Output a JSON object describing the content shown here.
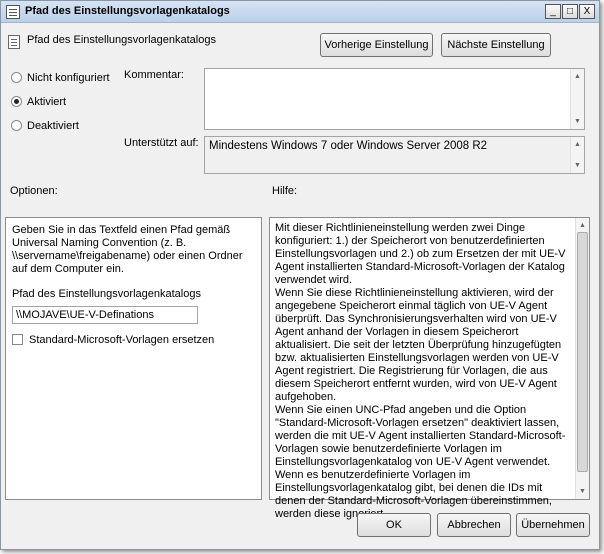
{
  "window": {
    "title": "Pfad des Einstellungsvorlagenkatalogs",
    "min": "_",
    "max": "□",
    "close": "X"
  },
  "header": {
    "title": "Pfad des Einstellungsvorlagenkatalogs",
    "prev_button": "Vorherige Einstellung",
    "next_button": "Nächste Einstellung"
  },
  "state": {
    "options": [
      "Nicht konfiguriert",
      "Aktiviert",
      "Deaktiviert"
    ],
    "selected": "Aktiviert"
  },
  "comment": {
    "label": "Kommentar:",
    "value": ""
  },
  "supported": {
    "label": "Unterstützt auf:",
    "value": "Mindestens Windows 7 oder Windows Server 2008 R2"
  },
  "options_section": {
    "label": "Optionen:",
    "description": "Geben Sie in das Textfeld einen Pfad gemäß Universal Naming Convention (z. B. \\\\servername\\freigabename) oder einen Ordner auf dem Computer ein.",
    "path_label": "Pfad des Einstellungsvorlagenkatalogs",
    "path_value": "\\\\MOJAVE\\UE-V-Definations",
    "checkbox_label": "Standard-Microsoft-Vorlagen ersetzen",
    "checkbox_checked": false
  },
  "help_section": {
    "label": "Hilfe:",
    "paragraphs": [
      "Mit dieser Richtlinieneinstellung werden zwei Dinge konfiguriert: 1.) der Speicherort von benutzerdefinierten Einstellungsvorlagen und 2.) ob zum Ersetzen der mit UE-V Agent installierten Standard-Microsoft-Vorlagen der Katalog verwendet wird.",
      "Wenn Sie diese Richtlinieneinstellung aktivieren, wird der angegebene Speicherort einmal täglich von UE-V Agent überprüft. Das Synchronisierungsverhalten wird von UE-V Agent anhand der Vorlagen in diesem Speicherort aktualisiert. Die seit der letzten Überprüfung hinzugefügten bzw. aktualisierten Einstellungsvorlagen werden von UE-V Agent registriert. Die Registrierung für Vorlagen, die aus diesem Speicherort entfernt wurden, wird von UE-V Agent aufgehoben.",
      "Wenn Sie einen UNC-Pfad angeben und die Option \"Standard-Microsoft-Vorlagen ersetzen\" deaktiviert lassen, werden die mit UE-V Agent installierten Standard-Microsoft-Vorlagen sowie benutzerdefinierte Vorlagen im Einstellungsvorlagenkatalog von UE-V Agent verwendet. Wenn es benutzerdefinierte Vorlagen im Einstellungsvorlagenkatalog gibt, bei denen die IDs mit denen der Standard-Microsoft-Vorlagen übereinstimmen, werden diese ignoriert."
    ]
  },
  "footer": {
    "ok": "OK",
    "cancel": "Abbrechen",
    "apply": "Übernehmen"
  }
}
